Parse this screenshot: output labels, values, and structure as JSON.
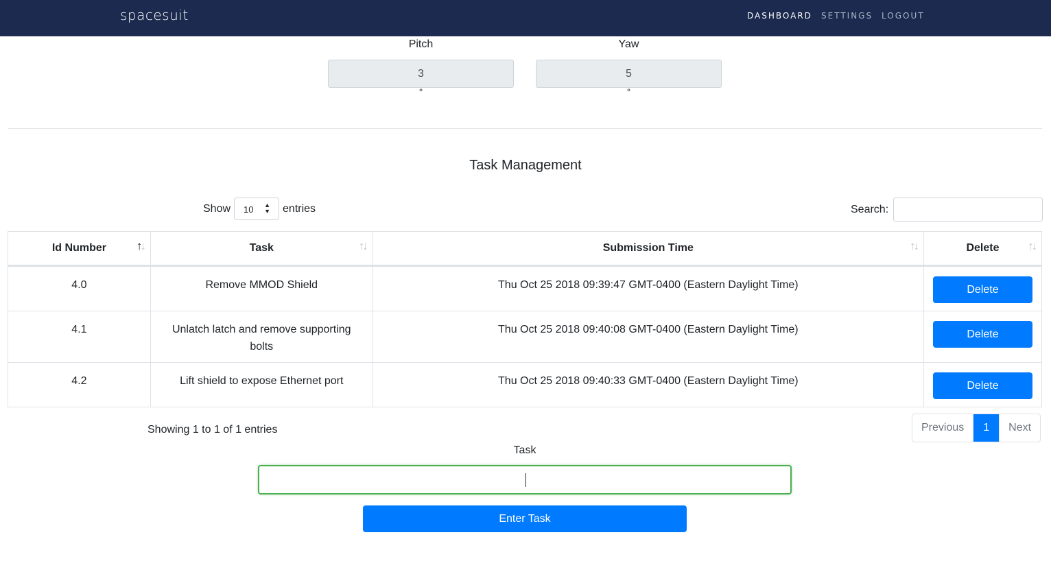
{
  "nav": {
    "brand": "spacesuit",
    "links": [
      "DASHBOARD",
      "SETTINGS",
      "LOGOUT"
    ]
  },
  "orientation": {
    "pitch": {
      "label": "Pitch",
      "value": "3",
      "unit": "°"
    },
    "yaw": {
      "label": "Yaw",
      "value": "5",
      "unit": "°"
    }
  },
  "task_management": {
    "title": "Task Management",
    "show_label": "Show",
    "entries_label": "entries",
    "page_length": "10",
    "search_label": "Search:",
    "search_value": "",
    "columns": [
      "Id Number",
      "Task",
      "Submission Time",
      "Delete"
    ],
    "rows": [
      {
        "id": "4.0",
        "task": "Remove MMOD Shield",
        "time": "Thu Oct 25 2018 09:39:47 GMT-0400 (Eastern Daylight Time)",
        "action": "Delete"
      },
      {
        "id": "4.1",
        "task": "Unlatch latch and remove supporting bolts",
        "time": "Thu Oct 25 2018 09:40:08 GMT-0400 (Eastern Daylight Time)",
        "action": "Delete"
      },
      {
        "id": "4.2",
        "task": "Lift shield to expose Ethernet port",
        "time": "Thu Oct 25 2018 09:40:33 GMT-0400 (Eastern Daylight Time)",
        "action": "Delete"
      }
    ],
    "info": "Showing 1 to 1 of 1 entries",
    "pagination": {
      "previous": "Previous",
      "current": "1",
      "next": "Next"
    }
  },
  "task_form": {
    "label": "Task",
    "value": "",
    "submit_label": "Enter Task"
  },
  "colors": {
    "navbar": "#1b2a4e",
    "primary": "#007bff",
    "focus_border": "#4caf50"
  }
}
